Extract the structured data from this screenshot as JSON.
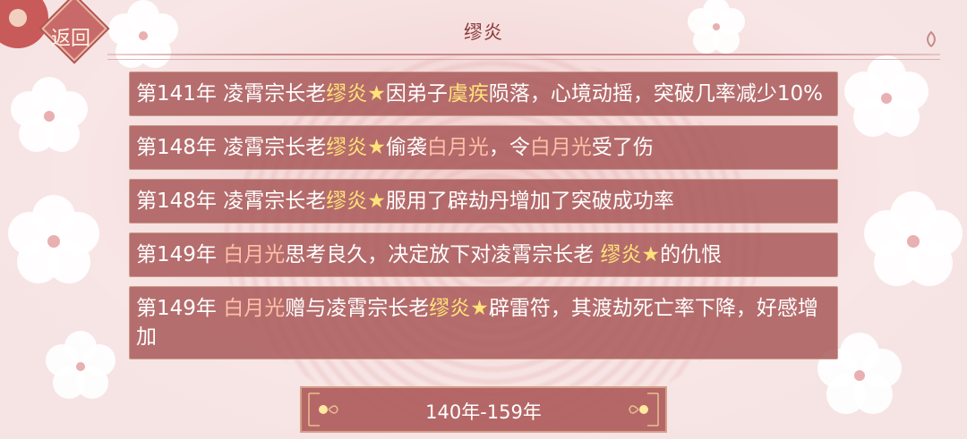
{
  "header": {
    "back_label": "返回",
    "title": "缪炎"
  },
  "entries": [
    {
      "year": "第141年",
      "parts": [
        {
          "text": " 凌霄宗长老",
          "style": "plain"
        },
        {
          "text": "缪炎",
          "style": "name"
        },
        {
          "text": "★",
          "style": "star"
        },
        {
          "text": "因弟子",
          "style": "plain"
        },
        {
          "text": "虞疾",
          "style": "name"
        },
        {
          "text": "陨落，心境动摇，突破几率减少10%",
          "style": "plain"
        }
      ]
    },
    {
      "year": "第148年",
      "parts": [
        {
          "text": " 凌霄宗长老",
          "style": "plain"
        },
        {
          "text": "缪炎",
          "style": "name"
        },
        {
          "text": "★",
          "style": "star"
        },
        {
          "text": "偷袭",
          "style": "plain"
        },
        {
          "text": "白月光",
          "style": "person"
        },
        {
          "text": "，令",
          "style": "plain"
        },
        {
          "text": "白月光",
          "style": "person"
        },
        {
          "text": "受了伤",
          "style": "plain"
        }
      ]
    },
    {
      "year": "第148年",
      "parts": [
        {
          "text": " 凌霄宗长老",
          "style": "plain"
        },
        {
          "text": "缪炎",
          "style": "name"
        },
        {
          "text": "★",
          "style": "star"
        },
        {
          "text": "服用了辟劫丹增加了突破成功率",
          "style": "plain"
        }
      ]
    },
    {
      "year": "第149年",
      "parts": [
        {
          "text": " ",
          "style": "plain"
        },
        {
          "text": "白月光",
          "style": "person"
        },
        {
          "text": "思考良久，决定放下对凌霄宗长老 ",
          "style": "plain"
        },
        {
          "text": "缪炎",
          "style": "name"
        },
        {
          "text": "★",
          "style": "star"
        },
        {
          "text": "的仇恨",
          "style": "plain"
        }
      ]
    },
    {
      "year": "第149年",
      "parts": [
        {
          "text": " ",
          "style": "plain"
        },
        {
          "text": "白月光",
          "style": "person"
        },
        {
          "text": "赠与凌霄宗长老",
          "style": "plain"
        },
        {
          "text": "缪炎",
          "style": "name"
        },
        {
          "text": "★",
          "style": "star"
        },
        {
          "text": "辟雷符，其渡劫死亡率下降，好感增加",
          "style": "plain"
        }
      ]
    }
  ],
  "footer": {
    "range_label": "140年-159年"
  },
  "colors": {
    "entry_bg": "#aa5a5a",
    "name_highlight": "#ffe27a",
    "person_highlight": "#ffc0a8",
    "title_color": "#8a3a3a"
  }
}
